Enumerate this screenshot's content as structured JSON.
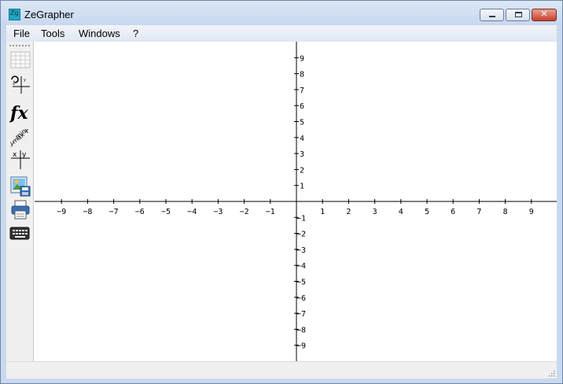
{
  "window": {
    "title": "ZeGrapher",
    "icon_text": "Zg",
    "minimize_glyph": "",
    "maximize_glyph": "",
    "close_glyph": "✕"
  },
  "menu": [
    "File",
    "Tools",
    "Windows",
    "?"
  ],
  "toolbar": [
    {
      "name": "grid-icon"
    },
    {
      "name": "axis-settings-icon"
    },
    {
      "name": "function-fx-icon",
      "text": "fx"
    },
    {
      "name": "range-min-max-icon",
      "text": [
        "x",
        "min",
        "max",
        "y"
      ]
    },
    {
      "name": "xy-table-icon",
      "text": [
        "x",
        "y"
      ]
    },
    {
      "name": "export-image-icon"
    },
    {
      "name": "print-icon"
    },
    {
      "name": "keyboard-icon"
    }
  ],
  "graph": {
    "x_ticks": [
      "-9",
      "-8",
      "-7",
      "-6",
      "-5",
      "-4",
      "-3",
      "-2",
      "-1",
      "1",
      "2",
      "3",
      "4",
      "5",
      "6",
      "7",
      "8",
      "9"
    ],
    "y_ticks_positive": [
      "9",
      "8",
      "7",
      "6",
      "5",
      "4",
      "3",
      "2",
      "1"
    ],
    "y_ticks_negative": [
      "-1",
      "-2",
      "-3",
      "-4",
      "-5",
      "-6",
      "-7",
      "-8",
      "-9"
    ],
    "x_range": [
      -9,
      9
    ],
    "y_range": [
      -9,
      9
    ]
  },
  "colors": {
    "window_frame": "#c9d9ee",
    "close_button": "#c6412d",
    "toolbar_bg": "#f0f0f0",
    "axis": "#000000"
  }
}
